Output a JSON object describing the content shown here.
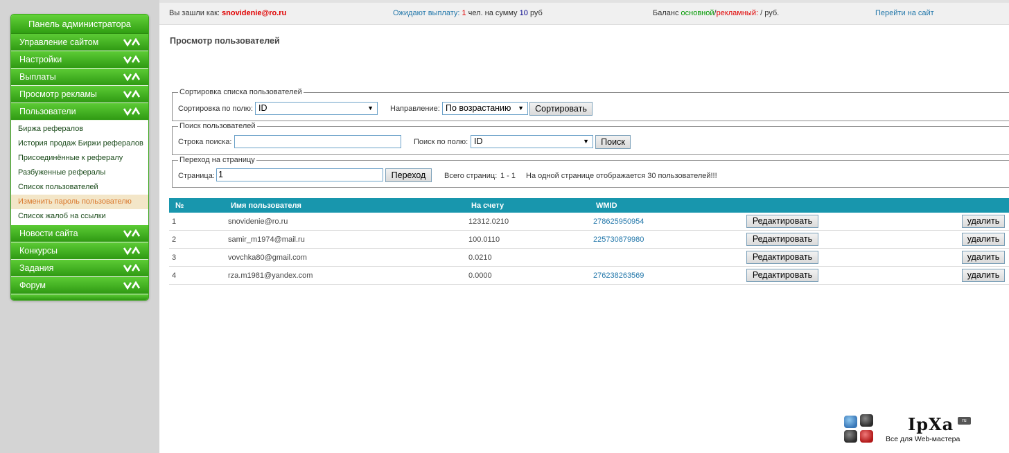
{
  "admin_panel": {
    "title": "Панель администратора",
    "sections": [
      {
        "label": "Управление сайтом"
      },
      {
        "label": "Настройки"
      },
      {
        "label": "Выплаты"
      },
      {
        "label": "Просмотр рекламы"
      },
      {
        "label": "Пользователи"
      }
    ],
    "users_submenu": [
      {
        "label": "Биржа рефералов"
      },
      {
        "label": "История продаж Биржи рефералов"
      },
      {
        "label": "Присоединённые к рефералу"
      },
      {
        "label": "Разбуженные рефералы"
      },
      {
        "label": "Список пользователей"
      },
      {
        "label": "Изменить пароль пользователю"
      },
      {
        "label": "Список жалоб на ссылки"
      }
    ],
    "sections_after": [
      {
        "label": "Новости сайта"
      },
      {
        "label": "Конкурсы"
      },
      {
        "label": "Задания"
      },
      {
        "label": "Форум"
      }
    ]
  },
  "topbar": {
    "logged_in_prefix": "Вы зашли как:",
    "logged_in_user": "snovidenie@ro.ru",
    "payout_prefix": "Ожидают выплату:",
    "payout_count": "1",
    "payout_middle": "чел. на сумму",
    "payout_amount": "10",
    "payout_suffix": "руб",
    "balance_prefix": "Баланс",
    "balance_main": "основной",
    "balance_slash": "/",
    "balance_ad": "рекламный:",
    "balance_value": "/ руб.",
    "goto_site": "Перейти на сайт"
  },
  "page": {
    "title": "Просмотр пользователей"
  },
  "sort_box": {
    "legend": "Сортировка списка пользователей",
    "field_label": "Сортировка по полю:",
    "field_value": "ID",
    "direction_label": "Направление:",
    "direction_value": "По возрастанию",
    "button": "Сортировать"
  },
  "search_box": {
    "legend": "Поиск пользователей",
    "query_label": "Строка поиска:",
    "query_value": "",
    "field_label": "Поиск по полю:",
    "field_value": "ID",
    "button": "Поиск"
  },
  "page_box": {
    "legend": "Переход на страницу",
    "page_label": "Страница:",
    "page_value": "1",
    "button": "Переход",
    "total_label": "Всего страниц:",
    "total_value": "1 - 1",
    "per_page_note": "На одной странице отображается 30 пользователей!!!"
  },
  "table": {
    "headers": {
      "num": "№",
      "name": "Имя пользователя",
      "balance": "На счету",
      "wmid": "WMID"
    },
    "edit_label": "Редактировать",
    "delete_label": "удалить",
    "rows": [
      {
        "num": "1",
        "name": "snovidenie@ro.ru",
        "balance": "12312.0210",
        "wmid": "278625950954"
      },
      {
        "num": "2",
        "name": "samir_m1974@mail.ru",
        "balance": "100.0110",
        "wmid": "225730879980"
      },
      {
        "num": "3",
        "name": "vovchka80@gmail.com",
        "balance": "0.0210",
        "wmid": ""
      },
      {
        "num": "4",
        "name": "rza.m1981@yandex.com",
        "balance": "0.0000",
        "wmid": "276238263569"
      }
    ]
  },
  "logo": {
    "name": "IpXa",
    "domain_badge": "ru",
    "tagline": "Все для Web-мастера"
  },
  "colors": {
    "menu_green": "#2f9a13",
    "table_header": "#1896ad",
    "link": "#2277aa",
    "active_item": "#d9772b"
  }
}
